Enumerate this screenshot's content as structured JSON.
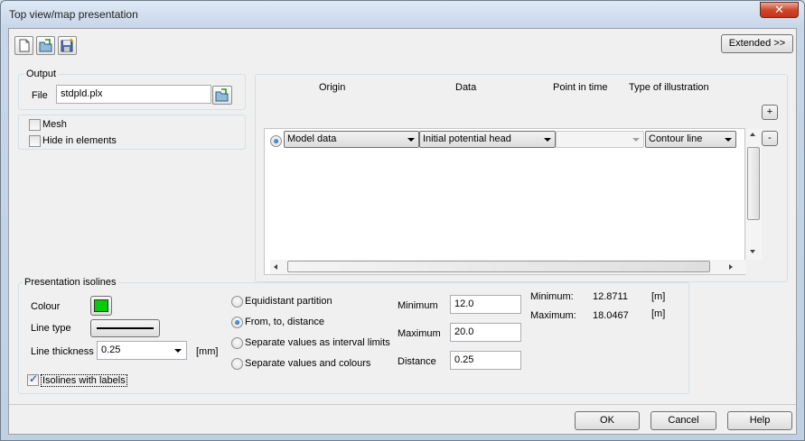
{
  "window": {
    "title": "Top view/map presentation",
    "close_label": "✕"
  },
  "toolbar": {
    "extended_label": "Extended >>"
  },
  "output": {
    "group_label": "Output",
    "file_label": "File",
    "file_value": "stdpld.plx"
  },
  "options": {
    "mesh_label": "Mesh",
    "hide_label": "Hide in elements"
  },
  "table": {
    "headers": {
      "origin": "Origin",
      "data": "Data",
      "point_in_time": "Point in time",
      "type": "Type of illustration"
    },
    "row": {
      "origin": "Model data",
      "data": "Initial potential head",
      "point_in_time": "",
      "type": "Contour line"
    },
    "add_label": "+",
    "remove_label": "-"
  },
  "isolines": {
    "group_label": "Presentation isolines",
    "colour_label": "Colour",
    "colour_value": "#00cc00",
    "line_type_label": "Line type",
    "line_thickness_label": "Line thickness",
    "line_thickness_value": "0.25",
    "unit_mm": "[mm]",
    "with_labels_label": "Isolines with labels",
    "partition_options": [
      "Equidistant partition",
      "From, to, distance",
      "Separate values as interval limits",
      "Separate values and colours"
    ],
    "minimum_label": "Minimum",
    "minimum_value": "12.0",
    "maximum_label": "Maximum",
    "maximum_value": "20.0",
    "distance_label": "Distance",
    "distance_value": "0.25",
    "stat_min_label": "Minimum:",
    "stat_min_value": "12.8711",
    "stat_max_label": "Maximum:",
    "stat_max_value": "18.0467",
    "unit_m": "[m]"
  },
  "buttons": {
    "ok": "OK",
    "cancel": "Cancel",
    "help": "Help"
  }
}
